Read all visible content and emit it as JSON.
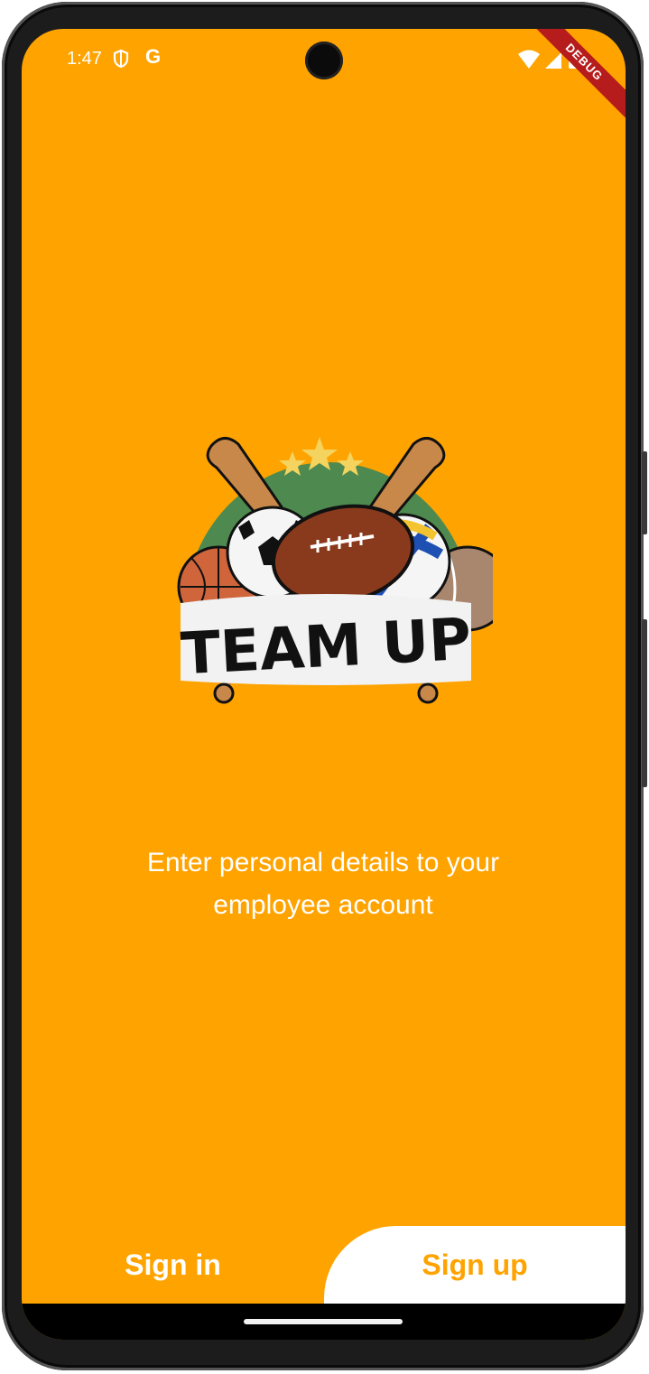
{
  "status_bar": {
    "time": "1:47",
    "google_glyph": "G",
    "debug_label": "DEBUG",
    "icons": [
      "shield-icon",
      "google-icon",
      "wifi-icon",
      "signal-icon",
      "battery-icon"
    ]
  },
  "logo": {
    "text": "TEAM UP",
    "colors": {
      "arch": "#4E8A4F",
      "banner": "#F2F2F2",
      "football": "#8A3A1C",
      "basketball": "#D0653C",
      "bat": "#C8884A",
      "star": "#F4D35E"
    }
  },
  "main": {
    "tagline_line1": "Enter personal details to your",
    "tagline_line2": "employee account"
  },
  "tabs": {
    "sign_in": "Sign in",
    "sign_up": "Sign up",
    "selected": "Sign up"
  },
  "colors": {
    "background": "#FFA300",
    "accent": "#FFA300",
    "text_light": "#FFFFFF",
    "debug_banner": "#B71C1C"
  }
}
